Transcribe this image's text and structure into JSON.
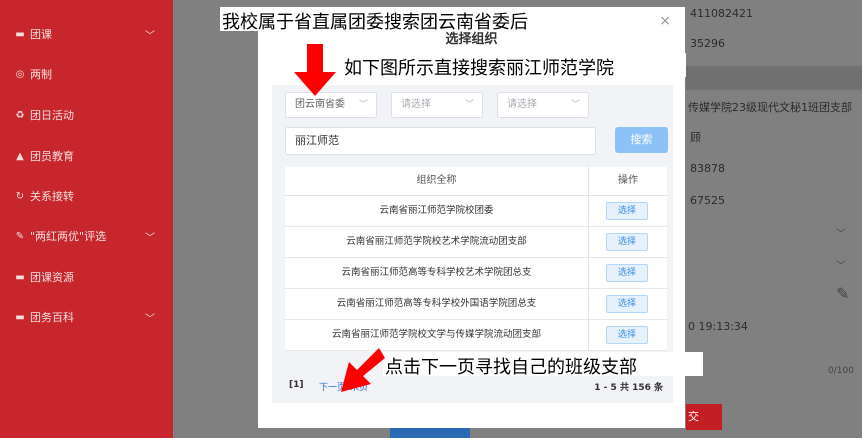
{
  "sidebar": {
    "items": [
      {
        "icon": "folder-icon",
        "label": "团课",
        "chev": "﹀"
      },
      {
        "icon": "target-icon",
        "label": "两制",
        "chev": ""
      },
      {
        "icon": "recycle-icon",
        "label": "团日活动",
        "chev": ""
      },
      {
        "icon": "graduation-cap-icon",
        "label": "团员教育",
        "chev": ""
      },
      {
        "icon": "refresh-icon",
        "label": "关系接转",
        "chev": ""
      },
      {
        "icon": "edit-icon",
        "label": "\"两红两优\"评选",
        "chev": "﹀"
      },
      {
        "icon": "folder-icon",
        "label": "团课资源",
        "chev": ""
      },
      {
        "icon": "folder-icon",
        "label": "团务百科",
        "chev": "﹀"
      }
    ]
  },
  "background": {
    "texts": [
      "411082421",
      "35296",
      "传媒学院23级现代文秘1班团支部",
      "顾",
      "83878",
      "67525",
      "0 19:13:34",
      "0/100",
      "交"
    ]
  },
  "modal": {
    "title": "选择组织",
    "close": "×",
    "filters": [
      "团云南省委",
      "请选择",
      "请选择"
    ],
    "search_value": "丽江师范",
    "search_button": "搜索",
    "table": {
      "headers": [
        "组织全称",
        "操作"
      ],
      "rows": [
        {
          "name": "云南省丽江师范学院校团委",
          "action": "选择"
        },
        {
          "name": "云南省丽江师范学院校艺术学院流动团支部",
          "action": "选择"
        },
        {
          "name": "云南省丽江师范高等专科学校艺术学院团总支",
          "action": "选择"
        },
        {
          "name": "云南省丽江师范高等专科学校外国语学院团总支",
          "action": "选择"
        },
        {
          "name": "云南省丽江师范学院校文学与传媒学院流动团支部",
          "action": "选择"
        }
      ]
    },
    "pager": {
      "current": "[1]",
      "next": "下一页",
      "last": "末页",
      "summary": "1 - 5  共 156 条"
    }
  },
  "annotations": {
    "top": "我校属于省直属团委搜索团云南省委后",
    "middle": "如下图所示直接搜索丽江师范学院",
    "bottom": "点击下一页寻找自己的班级支部"
  },
  "colors": {
    "sidebar": "#c7262c",
    "arrow": "#ff0000",
    "primary": "#409eff"
  }
}
